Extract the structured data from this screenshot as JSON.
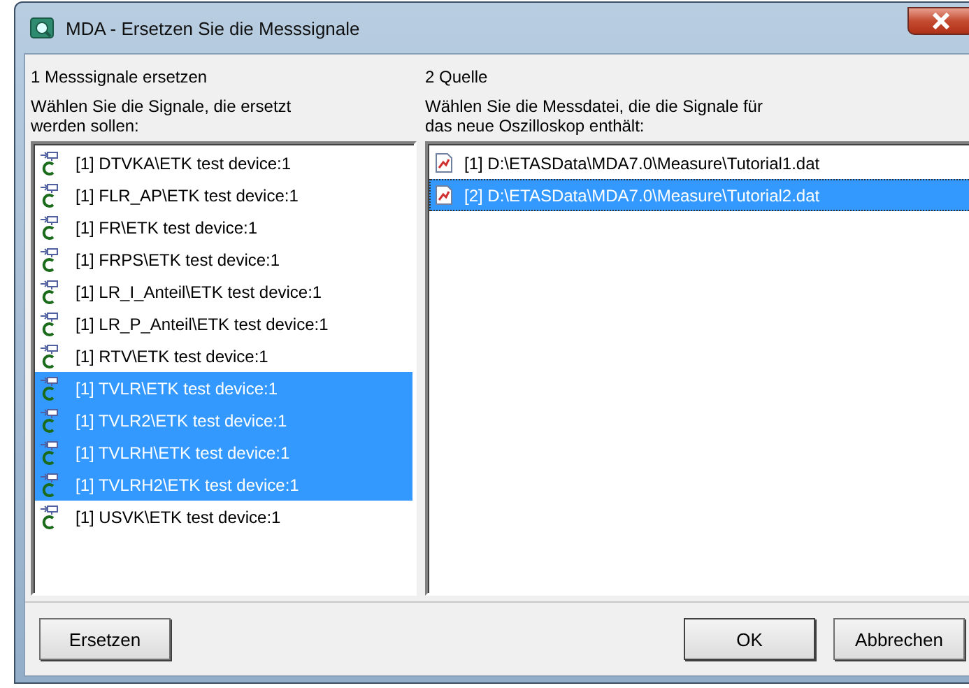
{
  "window": {
    "title": "MDA - Ersetzen Sie die Messsignale"
  },
  "left": {
    "heading": "1 Messsignale ersetzen",
    "instruction": "Wählen Sie die Signale, die ersetzt werden sollen:",
    "items": [
      {
        "label": "[1]  DTVKA\\ETK test device:1",
        "selected": false
      },
      {
        "label": "[1]  FLR_AP\\ETK test device:1",
        "selected": false
      },
      {
        "label": "[1]  FR\\ETK test device:1",
        "selected": false
      },
      {
        "label": "[1]  FRPS\\ETK test device:1",
        "selected": false
      },
      {
        "label": "[1]  LR_I_Anteil\\ETK test device:1",
        "selected": false
      },
      {
        "label": "[1]  LR_P_Anteil\\ETK test device:1",
        "selected": false
      },
      {
        "label": "[1]  RTV\\ETK test device:1",
        "selected": false
      },
      {
        "label": "[1]  TVLR\\ETK test device:1",
        "selected": true
      },
      {
        "label": "[1]  TVLR2\\ETK test device:1",
        "selected": true
      },
      {
        "label": "[1]  TVLRH\\ETK test device:1",
        "selected": true
      },
      {
        "label": "[1]  TVLRH2\\ETK test device:1",
        "selected": true
      },
      {
        "label": "[1]  USVK\\ETK test device:1",
        "selected": false
      }
    ]
  },
  "right": {
    "heading": "2 Quelle",
    "instruction": "Wählen Sie die Messdatei, die die Signale für das neue Oszilloskop enthält:",
    "items": [
      {
        "label": "[1]  D:\\ETASData\\MDA7.0\\Measure\\Tutorial1.dat",
        "selected": false
      },
      {
        "label": "[2]  D:\\ETASData\\MDA7.0\\Measure\\Tutorial2.dat",
        "selected": true
      }
    ]
  },
  "buttons": [
    {
      "label": "Ersetzen",
      "kind": "left"
    },
    {
      "label": "OK",
      "kind": "right"
    },
    {
      "label": "Abbrechen",
      "kind": "right"
    }
  ]
}
